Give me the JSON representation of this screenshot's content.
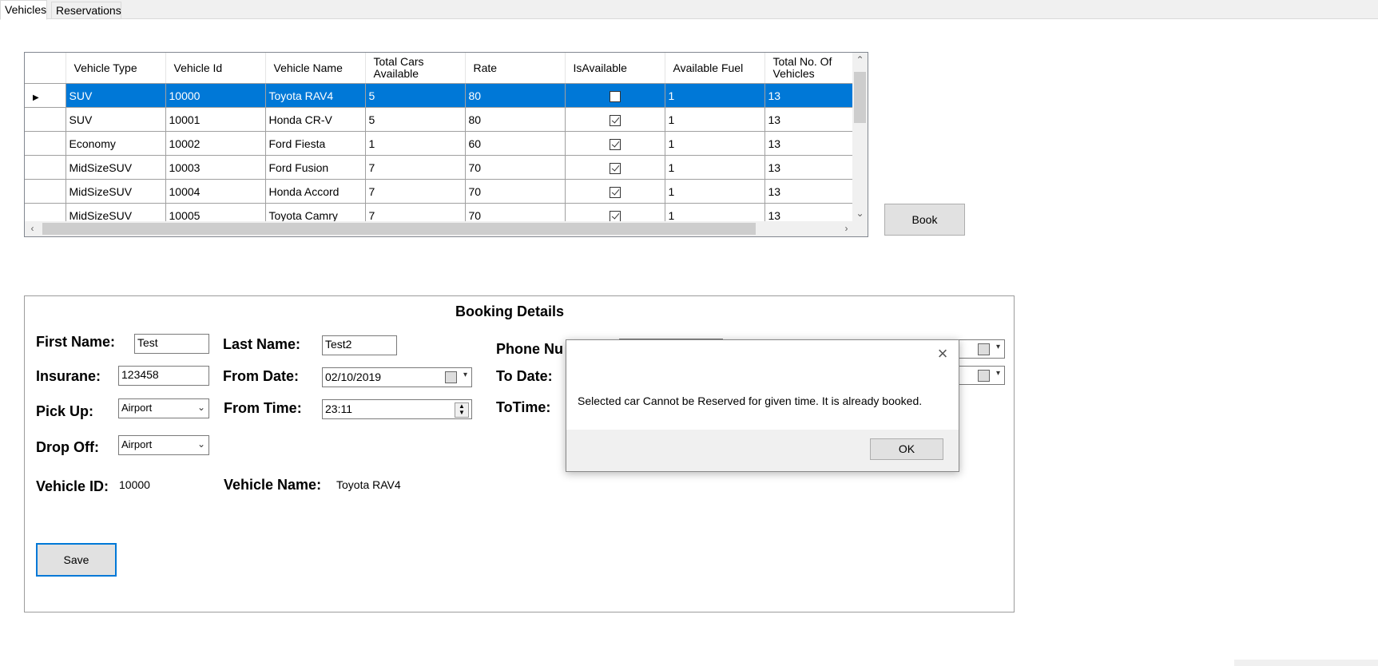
{
  "tabs": [
    {
      "label": "Vehicles"
    },
    {
      "label": "Reservations"
    }
  ],
  "grid": {
    "columns": [
      "Vehicle Type",
      "Vehicle Id",
      "Vehicle Name",
      "Total Cars Available",
      "Rate",
      "IsAvailable",
      "Available Fuel",
      "Total No. Of Vehicles"
    ],
    "rows": [
      {
        "type": "SUV",
        "id": "10000",
        "name": "Toyota RAV4",
        "total": "5",
        "rate": "80",
        "available": false,
        "fuel": "1",
        "count": "13",
        "selected": true
      },
      {
        "type": "SUV",
        "id": "10001",
        "name": "Honda CR-V",
        "total": "5",
        "rate": "80",
        "available": true,
        "fuel": "1",
        "count": "13"
      },
      {
        "type": "Economy",
        "id": "10002",
        "name": "Ford Fiesta",
        "total": "1",
        "rate": "60",
        "available": true,
        "fuel": "1",
        "count": "13"
      },
      {
        "type": "MidSizeSUV",
        "id": "10003",
        "name": "Ford Fusion",
        "total": "7",
        "rate": "70",
        "available": true,
        "fuel": "1",
        "count": "13"
      },
      {
        "type": "MidSizeSUV",
        "id": "10004",
        "name": "Honda Accord",
        "total": "7",
        "rate": "70",
        "available": true,
        "fuel": "1",
        "count": "13"
      },
      {
        "type": "MidSizeSUV",
        "id": "10005",
        "name": "Toyota Camry",
        "total": "7",
        "rate": "70",
        "available": true,
        "fuel": "1",
        "count": "13"
      }
    ]
  },
  "book_button": "Book",
  "booking": {
    "title": "Booking Details",
    "first_name_label": "First Name:",
    "first_name": "Test",
    "last_name_label": "Last Name:",
    "last_name": "Test2",
    "phone_label": "Phone Nu",
    "insurance_label": "Insurane:",
    "insurance": "123458",
    "from_date_label": "From Date:",
    "from_date": "02/10/2019",
    "to_date_label": "To Date:",
    "pickup_label": "Pick Up:",
    "pickup": "Airport",
    "from_time_label": "From Time:",
    "from_time": "23:11",
    "to_time_label": "ToTime:",
    "dropoff_label": "Drop Off:",
    "dropoff": "Airport",
    "vehicle_id_label": "Vehicle ID:",
    "vehicle_id": "10000",
    "vehicle_name_label": "Vehicle Name:",
    "vehicle_name": "Toyota RAV4",
    "save_button": "Save"
  },
  "dialog": {
    "message": "Selected car Cannot be Reserved for given time. It is already booked.",
    "ok_button": "OK"
  }
}
